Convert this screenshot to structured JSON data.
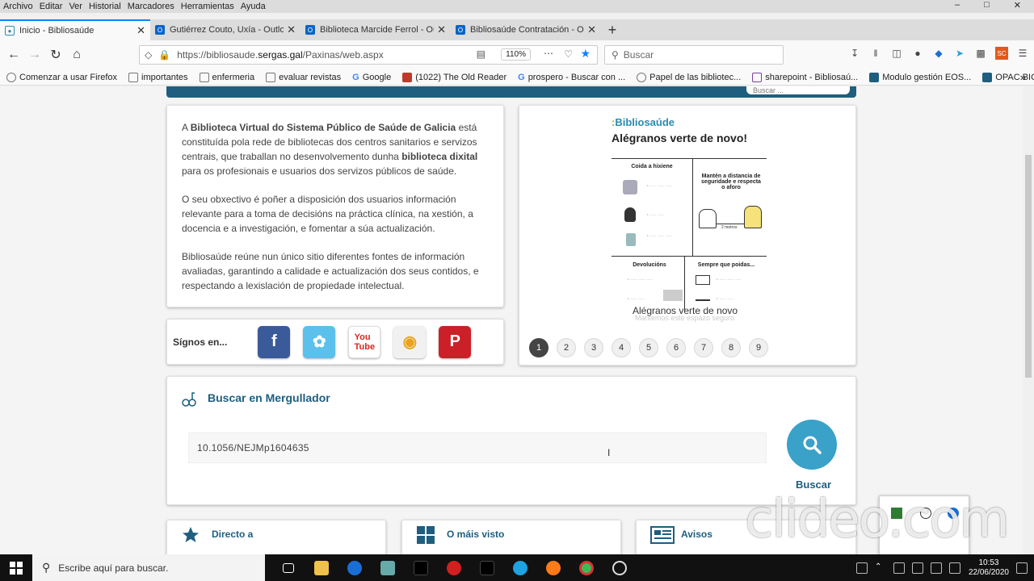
{
  "menubar": {
    "items": [
      "Archivo",
      "Editar",
      "Ver",
      "Historial",
      "Marcadores",
      "Herramientas",
      "Ayuda"
    ]
  },
  "tabs": [
    {
      "label": "Inicio - Bibliosaúde",
      "icon": "biblio-icon",
      "active": true
    },
    {
      "label": "Gutiérrez Couto, Uxía - Outlook",
      "icon": "outlook-icon",
      "active": false
    },
    {
      "label": "Biblioteca Marcide Ferrol - Out",
      "icon": "outlook-icon",
      "active": false
    },
    {
      "label": "Bibliosaúde Contratación - Out",
      "icon": "outlook-icon",
      "active": false
    }
  ],
  "navbar": {
    "url_prefix": "https://bibliosaude.",
    "url_domain": "sergas.gal",
    "url_path": "/Paxinas/web.aspx",
    "zoom": "110%",
    "search_placeholder": "Buscar"
  },
  "bookmarks": [
    "Comenzar a usar Firefox",
    "importantes",
    "enfermeria",
    "evaluar revistas",
    "Google",
    "(1022) The Old Reader",
    "prospero - Buscar con ...",
    "Papel de las bibliotec...",
    "sharepoint - Bibliosaú...",
    "Modulo gestión   EOS...",
    "OPAC BICO"
  ],
  "page": {
    "top_search_placeholder": "Buscar ...",
    "intro": {
      "p1_a": "A ",
      "p1_b": "Biblioteca Virtual do Sistema Público de Saúde de Galicia",
      "p1_c": " está constituída pola rede de bibliotecas dos centros sanitarios e servizos centrais, que traballan no desenvolvemento dunha ",
      "p1_d": "biblioteca dixital",
      "p1_e": " para os profesionais e usuarios dos servizos públicos de saúde.",
      "p2": "O seu obxectivo é poñer a disposición dos usuarios información relevante para a toma de decisións na práctica clínica, na xestión, a docencia e a investigación, e fomentar a súa actualización.",
      "p3": "Bibliosaúde reúne nun único sitio diferentes fontes de información avaliadas, garantindo a calidade e actualización dos seus contidos, e respectando a lexislación de propiedade intelectual."
    },
    "social": {
      "label": "Sígnos en...",
      "networks": [
        "facebook",
        "twitter",
        "youtube",
        "slideshare",
        "pinterest"
      ]
    },
    "slider": {
      "poster_brand_a": "Biblio",
      "poster_brand_b": "saúde",
      "poster_title": "Alégranos verte de novo!",
      "cells": [
        "Coida a hixiene",
        "Mantén a distancia de seguridade e respecta o aforo",
        "Devolucións",
        "Sempre que poidas..."
      ],
      "distance": "2 metros",
      "caption": "Alégranos verte de novo",
      "caption_sub": "Mantemos este espazo seguro",
      "pages": [
        "1",
        "2",
        "3",
        "4",
        "5",
        "6",
        "7",
        "8",
        "9"
      ],
      "active_page": "1"
    },
    "mergullador": {
      "title": "Buscar en Mergullador",
      "query": "10.1056/NEJMp1604635",
      "button_label": "Buscar"
    },
    "bottom_cards": [
      {
        "title": "Directo a",
        "icon": "star-icon"
      },
      {
        "title": "O máis visto",
        "icon": "grid-icon"
      },
      {
        "title": "Avisos",
        "icon": "news-icon"
      }
    ]
  },
  "watermark": "clideo.com",
  "taskbar": {
    "search_placeholder": "Escribe aquí para buscar.",
    "time": "10:53",
    "date": "22/06/2020"
  },
  "colors": {
    "brand_blue": "#1f5e7e",
    "button_blue": "#3aa1c9",
    "tab_accent": "#0a84ff"
  }
}
